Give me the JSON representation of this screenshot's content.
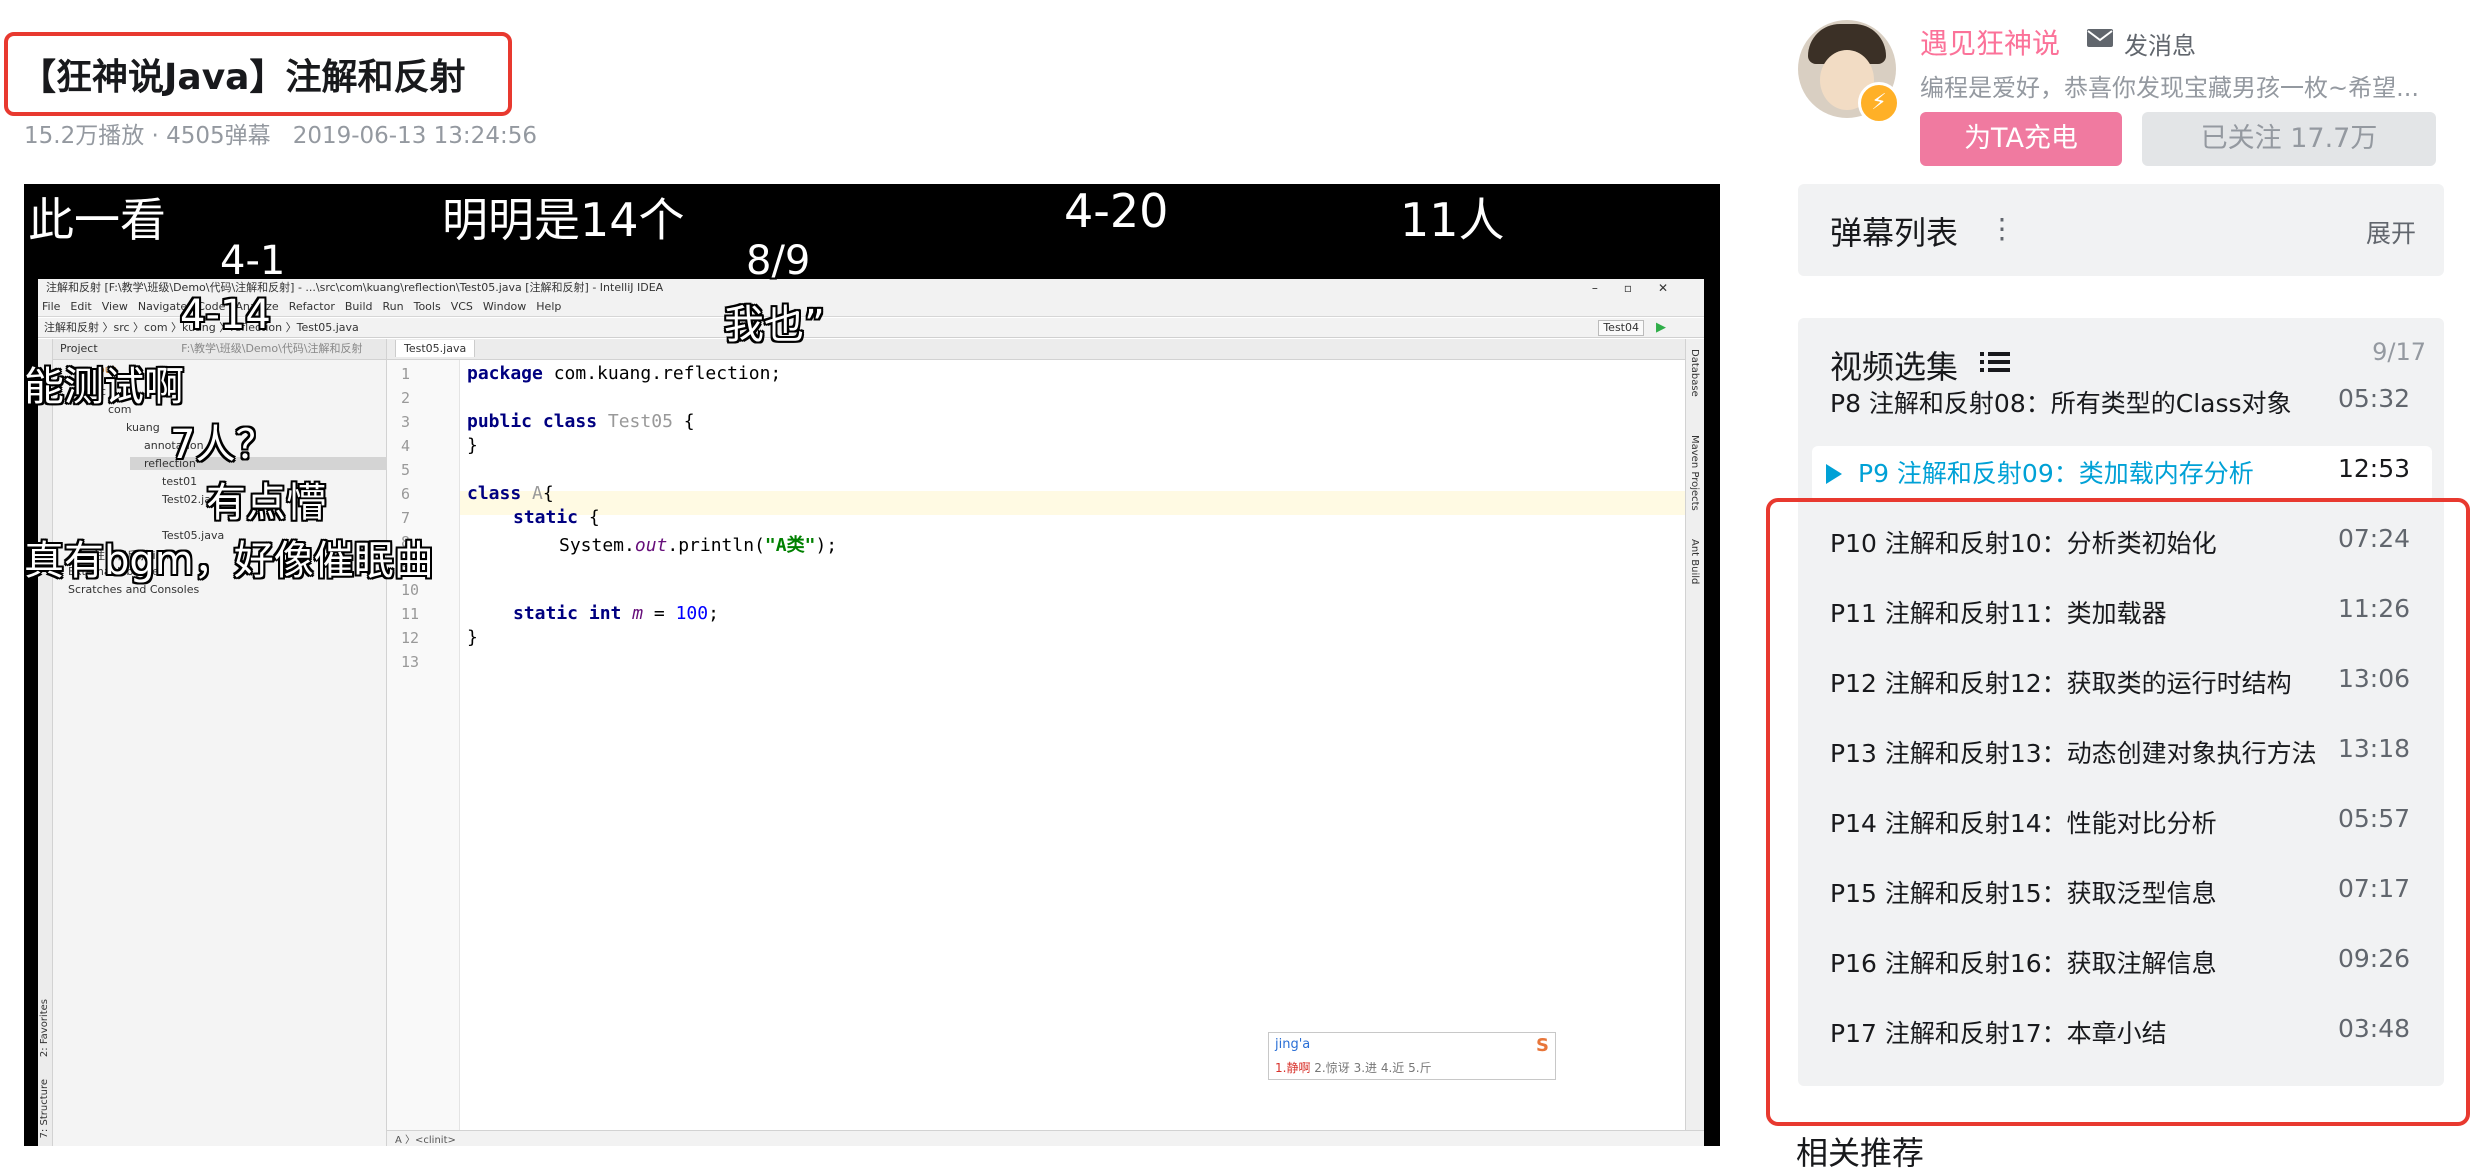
{
  "video": {
    "title": "【狂神说Java】注解和反射",
    "plays": "15.2万播放 · 4505弹幕",
    "date": "2019-06-13 13:24:56"
  },
  "danmaku": [
    "此一看",
    "明明是14个",
    "4-20",
    "11人",
    "4-1",
    "8/9",
    "4-14",
    "我也”",
    "能测试啊",
    "7人？",
    "有点懵",
    "真有bgm，好像催眠曲"
  ],
  "ide": {
    "window_title": "注解和反射 [F:\\教学\\班级\\Demo\\代码\\注解和反射] - ...\\src\\com\\kuang\\reflection\\Test05.java [注解和反射] - IntelliJ IDEA",
    "menu": [
      "File",
      "Edit",
      "View",
      "Navigate",
      "Code",
      "Analyze",
      "Refactor",
      "Build",
      "Run",
      "Tools",
      "VCS",
      "Window",
      "Help"
    ],
    "breadcrumb": "注解和反射 〉src 〉com 〉kuang 〉reflection 〉Test05.java",
    "run_config": "Test04",
    "project_label": "Project",
    "project_path": "F:\\教学\\班级\\Demo\\代码\\注解和反射",
    "editor_tab": "Test05.java",
    "tree": [
      "out",
      "src",
      "com",
      "kuang",
      "annotation",
      "reflection",
      "test01",
      "Test02.java",
      "Test05.java",
      "注解和反射.iml",
      "External Libraries",
      "Scratches and Consoles"
    ],
    "line_numbers": [
      "1",
      "2",
      "3",
      "4",
      "5",
      "6",
      "7",
      "8",
      "9",
      "10",
      "11",
      "12",
      "13"
    ],
    "code": {
      "l1_kw": "package",
      "l1_rest": " com.kuang.reflection;",
      "l3_kw": "public class",
      "l3_name": " Test05",
      "l3_rest": " {",
      "l4": "}",
      "l6_kw": "class",
      "l6_name": " A",
      "l6_rest": "{",
      "l7_kw": "static",
      "l7_rest": " {",
      "l8_pre": "System.",
      "l8_out": "out",
      "l8_mid": ".println(",
      "l8_str": "\"A类\"",
      "l8_end": ");",
      "l9": "}",
      "l11_kw": "static int",
      "l11_var": " m",
      "l11_mid": " = ",
      "l11_num": "100",
      "l11_end": ";",
      "l12": "}"
    },
    "status": "A 〉<clinit>",
    "side_tabs": [
      "2: Favorites",
      "7: Structure"
    ],
    "right_tabs": [
      "Database",
      "Maven Projects",
      "Ant Build"
    ],
    "ime": {
      "input": "jing'a",
      "candidates": [
        "1.静啊",
        "2.惊讶",
        "3.进",
        "4.近",
        "5.斤"
      ],
      "logo": "S"
    }
  },
  "uploader": {
    "name": "遇见狂神说",
    "message_label": "发消息",
    "description": "编程是爱好，恭喜你发现宝藏男孩一枚~希望...",
    "charge_label": "为TA充电",
    "follow_label": "已关注 17.7万"
  },
  "danmaku_panel": {
    "title": "弹幕列表",
    "expand_label": "展开"
  },
  "episodes": {
    "title": "视频选集",
    "count": "9/17",
    "items": [
      {
        "label": "P8   注解和反射08：所有类型的Class对象",
        "duration": "05:32"
      },
      {
        "label": "P9   注解和反射09：类加载内存分析",
        "duration": "12:53"
      },
      {
        "label": "P10   注解和反射10：分析类初始化",
        "duration": "07:24"
      },
      {
        "label": "P11   注解和反射11：类加载器",
        "duration": "11:26"
      },
      {
        "label": "P12   注解和反射12：获取类的运行时结构",
        "duration": "13:06"
      },
      {
        "label": "P13   注解和反射13：动态创建对象执行方法",
        "duration": "13:18"
      },
      {
        "label": "P14   注解和反射14：性能对比分析",
        "duration": "05:57"
      },
      {
        "label": "P15   注解和反射15：获取泛型信息",
        "duration": "07:17"
      },
      {
        "label": "P16   注解和反射16：获取注解信息",
        "duration": "09:26"
      },
      {
        "label": "P17   注解和反射17：本章小结",
        "duration": "03:48"
      }
    ],
    "current_index": 1
  },
  "related_title": "相关推荐",
  "colors": {
    "accent_pink": "#fb7299",
    "active_blue": "#00a1d6",
    "highlight_red": "#e8392f"
  }
}
